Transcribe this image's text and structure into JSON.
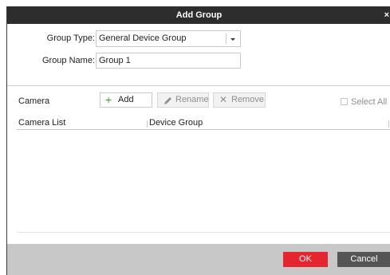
{
  "dialog": {
    "title": "Add Group",
    "close_glyph": "×"
  },
  "form": {
    "group_type_label": "Group Type:",
    "group_type_value": "General Device Group",
    "group_name_label": "Group Name:",
    "group_name_value": "Group 1"
  },
  "camera": {
    "label": "Camera",
    "add_label": "Add",
    "rename_label": "Rename",
    "remove_label": "Remove",
    "select_all_label": "Select All"
  },
  "list": {
    "columns": [
      "Camera List",
      "Device Group"
    ],
    "rows": []
  },
  "footer": {
    "ok_label": "OK",
    "cancel_label": "Cancel"
  },
  "colors": {
    "titlebar": "#2d2d2d",
    "accent_ok": "#e5262e",
    "cancel": "#555555",
    "add_icon": "#3a9d2a"
  },
  "icons": {
    "add": "plus-icon",
    "rename": "pencil-icon",
    "remove": "x-icon",
    "dropdown": "caret-down-icon",
    "close": "close-icon"
  }
}
